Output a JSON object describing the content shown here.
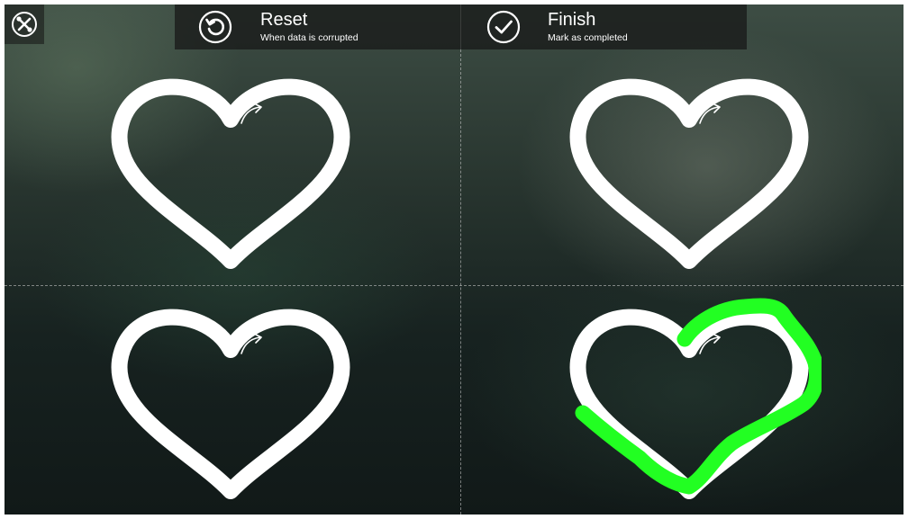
{
  "toolbar": {
    "settings_icon": "wrench-screwdriver-icon",
    "reset": {
      "icon": "refresh-circle-icon",
      "title": "Reset",
      "subtitle": "When data is corrupted"
    },
    "finish": {
      "icon": "checkmark-circle-icon",
      "title": "Finish",
      "subtitle": "Mark as completed"
    }
  },
  "panels": [
    {
      "name": "top-left",
      "shape": "heart",
      "direction_icon": "arrow-icon",
      "traced": false
    },
    {
      "name": "top-right",
      "shape": "heart",
      "direction_icon": "arrow-icon",
      "traced": false
    },
    {
      "name": "bottom-left",
      "shape": "heart",
      "direction_icon": "arrow-icon",
      "traced": false
    },
    {
      "name": "bottom-right",
      "shape": "heart",
      "direction_icon": "arrow-icon",
      "traced": true,
      "trace_color": "#22ff22"
    }
  ],
  "colors": {
    "shape_stroke": "#ffffff",
    "trace": "#22ff22",
    "toolbar_bg": "#161616"
  }
}
